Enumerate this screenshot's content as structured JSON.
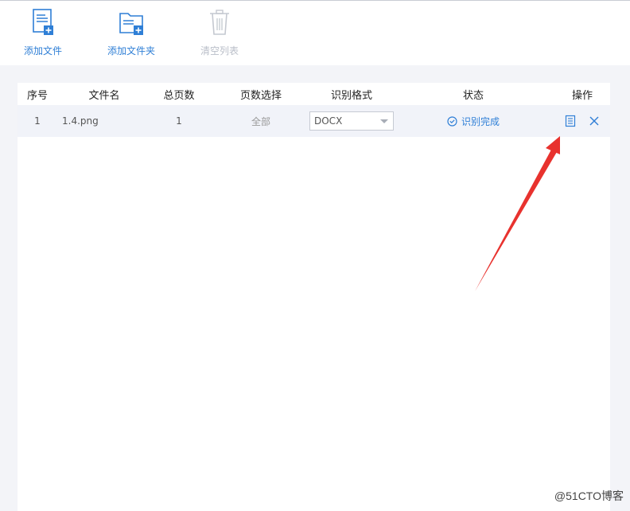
{
  "toolbar": {
    "add_file": {
      "label": "添加文件",
      "icon": "add-file-icon"
    },
    "add_folder": {
      "label": "添加文件夹",
      "icon": "add-folder-icon"
    },
    "clear_list": {
      "label": "清空列表",
      "icon": "trash-icon",
      "enabled": false
    }
  },
  "table": {
    "columns": [
      "序号",
      "文件名",
      "总页数",
      "页数选择",
      "识别格式",
      "状态",
      "操作"
    ],
    "rows": [
      {
        "index": "1",
        "filename": "1.4.png",
        "total_pages": "1",
        "page_selection": "全部",
        "format": "DOCX",
        "status": "识别完成",
        "actions": [
          "view-document-icon",
          "close-icon"
        ]
      }
    ]
  },
  "watermark": "@51CTO博客",
  "colors": {
    "accent": "#2f7fd6",
    "disabled": "#b9bec8",
    "annotation_arrow": "#e8322e",
    "row_background": "#f1f3f9",
    "page_background": "#f3f4f8"
  }
}
